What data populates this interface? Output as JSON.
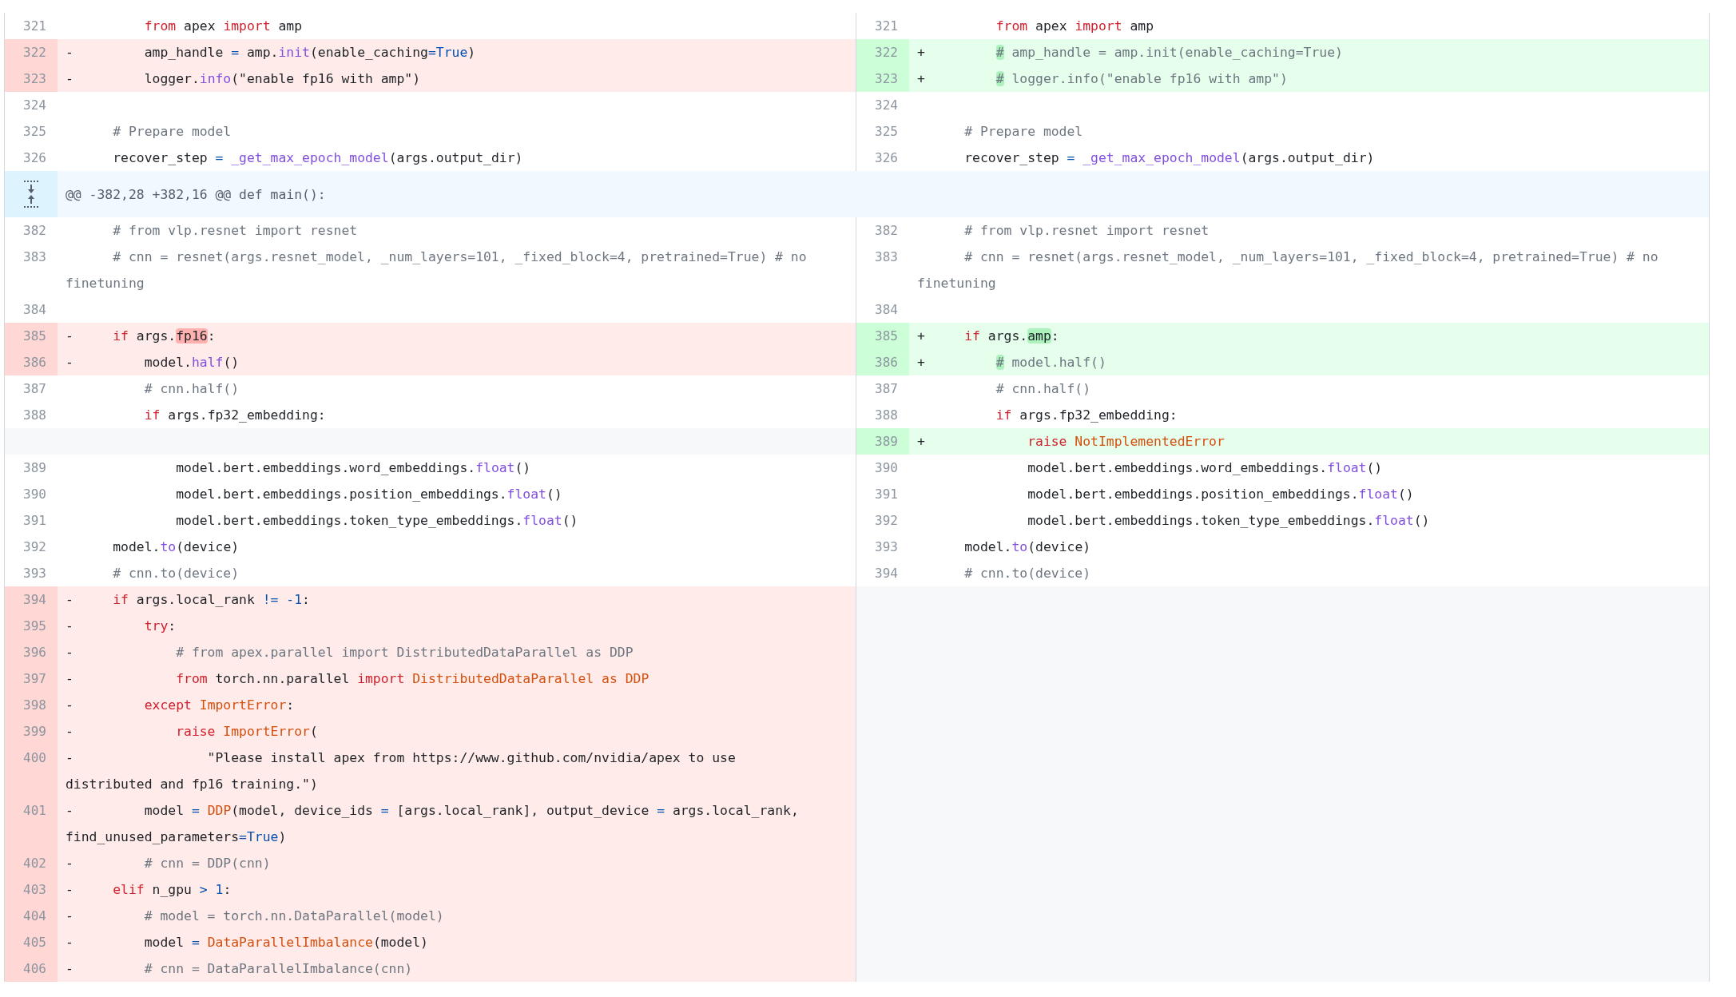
{
  "rows": [
    {
      "kind": "line",
      "left": {
        "num": "321",
        "kind": "ctx",
        "code": [
          {
            "t": "        from",
            "kind": "kw"
          },
          {
            "t": " apex "
          },
          {
            "t": "import",
            "kind": "kw"
          },
          {
            "t": " amp"
          }
        ]
      },
      "right": {
        "num": "321",
        "kind": "ctx",
        "code": [
          {
            "t": "        from",
            "kind": "kw"
          },
          {
            "t": " apex "
          },
          {
            "t": "import",
            "kind": "kw"
          },
          {
            "t": " amp"
          }
        ]
      }
    },
    {
      "kind": "line",
      "left": {
        "num": "322",
        "kind": "del",
        "marker": "-",
        "code": [
          {
            "t": "        amp_handle "
          },
          {
            "t": "=",
            "kind": "op"
          },
          {
            "t": " amp."
          },
          {
            "t": "init",
            "kind": "fn"
          },
          {
            "t": "(enable_caching"
          },
          {
            "t": "=",
            "kind": "op"
          },
          {
            "t": "True",
            "kind": "op"
          },
          {
            "t": ")"
          }
        ]
      },
      "right": {
        "num": "322",
        "kind": "add",
        "marker": "+",
        "code": [
          {
            "t": "        #",
            "kind": "cm",
            "hl": true
          },
          {
            "t": " amp_handle = amp.init(enable_caching=True)",
            "kind": "cm"
          }
        ]
      }
    },
    {
      "kind": "line",
      "left": {
        "num": "323",
        "kind": "del",
        "marker": "-",
        "code": [
          {
            "t": "        logger."
          },
          {
            "t": "info",
            "kind": "fn"
          },
          {
            "t": "(\"enable fp16 with amp\")"
          }
        ]
      },
      "right": {
        "num": "323",
        "kind": "add",
        "marker": "+",
        "code": [
          {
            "t": "        #",
            "kind": "cm",
            "hl": true
          },
          {
            "t": " logger.info(\"enable fp16 with amp\")",
            "kind": "cm"
          }
        ]
      }
    },
    {
      "kind": "line",
      "left": {
        "num": "324",
        "kind": "ctx"
      },
      "right": {
        "num": "324",
        "kind": "ctx"
      }
    },
    {
      "kind": "line",
      "left": {
        "num": "325",
        "kind": "ctx",
        "code": [
          {
            "t": "    # Prepare model",
            "kind": "cm"
          }
        ]
      },
      "right": {
        "num": "325",
        "kind": "ctx",
        "code": [
          {
            "t": "    # Prepare model",
            "kind": "cm"
          }
        ]
      }
    },
    {
      "kind": "line",
      "left": {
        "num": "326",
        "kind": "ctx",
        "code": [
          {
            "t": "    recover_step "
          },
          {
            "t": "= ",
            "kind": "op"
          },
          {
            "t": "_get_max_epoch_model",
            "kind": "fn"
          },
          {
            "t": "(args.output_dir)"
          }
        ]
      },
      "right": {
        "num": "326",
        "kind": "ctx",
        "code": [
          {
            "t": "    recover_step "
          },
          {
            "t": "= ",
            "kind": "op"
          },
          {
            "t": "_get_max_epoch_model",
            "kind": "fn"
          },
          {
            "t": "(args.output_dir)"
          }
        ]
      }
    },
    {
      "kind": "hunk",
      "text": "@@ -382,28 +382,16 @@ def main():"
    },
    {
      "kind": "line",
      "left": {
        "num": "382",
        "kind": "ctx",
        "code": [
          {
            "t": "    # from vlp.resnet import resnet",
            "kind": "cm"
          }
        ]
      },
      "right": {
        "num": "382",
        "kind": "ctx",
        "code": [
          {
            "t": "    # from vlp.resnet import resnet",
            "kind": "cm"
          }
        ]
      }
    },
    {
      "kind": "line",
      "left": {
        "num": "383",
        "kind": "ctx",
        "code": [
          {
            "t": "    # cnn = resnet(args.resnet_model, _num_layers=101, _fixed_block=4, pretrained=True) # no finetuning",
            "kind": "cm"
          }
        ]
      },
      "right": {
        "num": "383",
        "kind": "ctx",
        "code": [
          {
            "t": "    # cnn = resnet(args.resnet_model, _num_layers=101, _fixed_block=4, pretrained=True) # no finetuning",
            "kind": "cm"
          }
        ]
      }
    },
    {
      "kind": "line",
      "left": {
        "num": "384",
        "kind": "ctx"
      },
      "right": {
        "num": "384",
        "kind": "ctx"
      }
    },
    {
      "kind": "line",
      "left": {
        "num": "385",
        "kind": "del",
        "marker": "-",
        "code": [
          {
            "t": "    if",
            "kind": "kw"
          },
          {
            "t": " args."
          },
          {
            "t": "fp16",
            "hl": true
          },
          {
            "t": ":"
          }
        ]
      },
      "right": {
        "num": "385",
        "kind": "add",
        "marker": "+",
        "code": [
          {
            "t": "    if",
            "kind": "kw"
          },
          {
            "t": " args."
          },
          {
            "t": "amp",
            "hl": true
          },
          {
            "t": ":"
          }
        ]
      }
    },
    {
      "kind": "line",
      "left": {
        "num": "386",
        "kind": "del",
        "marker": "-",
        "code": [
          {
            "t": "        model."
          },
          {
            "t": "half",
            "kind": "fn"
          },
          {
            "t": "()"
          }
        ]
      },
      "right": {
        "num": "386",
        "kind": "add",
        "marker": "+",
        "code": [
          {
            "t": "        #",
            "kind": "cm",
            "hl": true
          },
          {
            "t": " model.half()",
            "kind": "cm"
          }
        ]
      }
    },
    {
      "kind": "line",
      "left": {
        "num": "387",
        "kind": "ctx",
        "code": [
          {
            "t": "        # cnn.half()",
            "kind": "cm"
          }
        ]
      },
      "right": {
        "num": "387",
        "kind": "ctx",
        "code": [
          {
            "t": "        # cnn.half()",
            "kind": "cm"
          }
        ]
      }
    },
    {
      "kind": "line",
      "left": {
        "num": "388",
        "kind": "ctx",
        "code": [
          {
            "t": "        if",
            "kind": "kw"
          },
          {
            "t": " args.fp32_embedding:"
          }
        ]
      },
      "right": {
        "num": "388",
        "kind": "ctx",
        "code": [
          {
            "t": "        if",
            "kind": "kw"
          },
          {
            "t": " args.fp32_embedding:"
          }
        ]
      }
    },
    {
      "kind": "line",
      "left": {
        "kind": "blank"
      },
      "right": {
        "num": "389",
        "kind": "add",
        "marker": "+",
        "code": [
          {
            "t": "            raise",
            "kind": "kw"
          },
          {
            "t": " NotImplementedError",
            "kind": "cls"
          }
        ]
      }
    },
    {
      "kind": "line",
      "left": {
        "num": "389",
        "kind": "ctx",
        "code": [
          {
            "t": "            model.bert.embeddings.word_embeddings."
          },
          {
            "t": "float",
            "kind": "fn"
          },
          {
            "t": "()"
          }
        ]
      },
      "right": {
        "num": "390",
        "kind": "ctx",
        "code": [
          {
            "t": "            model.bert.embeddings.word_embeddings."
          },
          {
            "t": "float",
            "kind": "fn"
          },
          {
            "t": "()"
          }
        ]
      }
    },
    {
      "kind": "line",
      "left": {
        "num": "390",
        "kind": "ctx",
        "code": [
          {
            "t": "            model.bert.embeddings.position_embeddings."
          },
          {
            "t": "float",
            "kind": "fn"
          },
          {
            "t": "()"
          }
        ]
      },
      "right": {
        "num": "391",
        "kind": "ctx",
        "code": [
          {
            "t": "            model.bert.embeddings.position_embeddings."
          },
          {
            "t": "float",
            "kind": "fn"
          },
          {
            "t": "()"
          }
        ]
      }
    },
    {
      "kind": "line",
      "left": {
        "num": "391",
        "kind": "ctx",
        "code": [
          {
            "t": "            model.bert.embeddings.token_type_embeddings."
          },
          {
            "t": "float",
            "kind": "fn"
          },
          {
            "t": "()"
          }
        ]
      },
      "right": {
        "num": "392",
        "kind": "ctx",
        "code": [
          {
            "t": "            model.bert.embeddings.token_type_embeddings."
          },
          {
            "t": "float",
            "kind": "fn"
          },
          {
            "t": "()"
          }
        ]
      }
    },
    {
      "kind": "line",
      "left": {
        "num": "392",
        "kind": "ctx",
        "code": [
          {
            "t": "    model."
          },
          {
            "t": "to",
            "kind": "fn"
          },
          {
            "t": "(device)"
          }
        ]
      },
      "right": {
        "num": "393",
        "kind": "ctx",
        "code": [
          {
            "t": "    model."
          },
          {
            "t": "to",
            "kind": "fn"
          },
          {
            "t": "(device)"
          }
        ]
      }
    },
    {
      "kind": "line",
      "left": {
        "num": "393",
        "kind": "ctx",
        "code": [
          {
            "t": "    # cnn.to(device)",
            "kind": "cm"
          }
        ]
      },
      "right": {
        "num": "394",
        "kind": "ctx",
        "code": [
          {
            "t": "    # cnn.to(device)",
            "kind": "cm"
          }
        ]
      }
    },
    {
      "kind": "line",
      "left": {
        "num": "394",
        "kind": "del",
        "marker": "-",
        "code": [
          {
            "t": "    if",
            "kind": "kw"
          },
          {
            "t": " args.local_rank "
          },
          {
            "t": "!= -1",
            "kind": "op"
          },
          {
            "t": ":"
          }
        ]
      },
      "right": {
        "kind": "blank"
      }
    },
    {
      "kind": "line",
      "left": {
        "num": "395",
        "kind": "del",
        "marker": "-",
        "code": [
          {
            "t": "        try",
            "kind": "kw"
          },
          {
            "t": ":"
          }
        ]
      },
      "right": {
        "kind": "blank"
      }
    },
    {
      "kind": "line",
      "left": {
        "num": "396",
        "kind": "del",
        "marker": "-",
        "code": [
          {
            "t": "            # from apex.parallel import DistributedDataParallel as DDP",
            "kind": "cm"
          }
        ]
      },
      "right": {
        "kind": "blank"
      }
    },
    {
      "kind": "line",
      "left": {
        "num": "397",
        "kind": "del",
        "marker": "-",
        "code": [
          {
            "t": "            from",
            "kind": "kw"
          },
          {
            "t": " torch.nn.parallel "
          },
          {
            "t": "import",
            "kind": "kw"
          },
          {
            "t": " DistributedDataParallel as DDP",
            "kind": "cls"
          }
        ]
      },
      "right": {
        "kind": "blank"
      }
    },
    {
      "kind": "line",
      "left": {
        "num": "398",
        "kind": "del",
        "marker": "-",
        "code": [
          {
            "t": "        except",
            "kind": "kw"
          },
          {
            "t": " ImportError",
            "kind": "cls"
          },
          {
            "t": ":"
          }
        ]
      },
      "right": {
        "kind": "blank"
      }
    },
    {
      "kind": "line",
      "left": {
        "num": "399",
        "kind": "del",
        "marker": "-",
        "code": [
          {
            "t": "            raise",
            "kind": "kw"
          },
          {
            "t": " ImportError",
            "kind": "cls"
          },
          {
            "t": "("
          }
        ]
      },
      "right": {
        "kind": "blank"
      }
    },
    {
      "kind": "line",
      "left": {
        "num": "400",
        "kind": "del",
        "marker": "-",
        "code": [
          {
            "t": "                \"Please install apex from https://www.github.com/nvidia/apex to use distributed and fp16 training.\")"
          }
        ]
      },
      "right": {
        "kind": "blank"
      }
    },
    {
      "kind": "line",
      "left": {
        "num": "401",
        "kind": "del",
        "marker": "-",
        "code": [
          {
            "t": "        model "
          },
          {
            "t": "= ",
            "kind": "op"
          },
          {
            "t": "DDP",
            "kind": "cls"
          },
          {
            "t": "(model, device_ids "
          },
          {
            "t": "=",
            "kind": "op"
          },
          {
            "t": " [args.local_rank], output_device "
          },
          {
            "t": "=",
            "kind": "op"
          },
          {
            "t": " args.local_rank, find_unused_parameters"
          },
          {
            "t": "=True",
            "kind": "op"
          },
          {
            "t": ")"
          }
        ]
      },
      "right": {
        "kind": "blank"
      }
    },
    {
      "kind": "line",
      "left": {
        "num": "402",
        "kind": "del",
        "marker": "-",
        "code": [
          {
            "t": "        # cnn = DDP(cnn)",
            "kind": "cm"
          }
        ]
      },
      "right": {
        "kind": "blank"
      }
    },
    {
      "kind": "line",
      "left": {
        "num": "403",
        "kind": "del",
        "marker": "-",
        "code": [
          {
            "t": "    elif",
            "kind": "kw"
          },
          {
            "t": " n_gpu "
          },
          {
            "t": "> 1",
            "kind": "op"
          },
          {
            "t": ":"
          }
        ]
      },
      "right": {
        "kind": "blank"
      }
    },
    {
      "kind": "line",
      "left": {
        "num": "404",
        "kind": "del",
        "marker": "-",
        "code": [
          {
            "t": "        # model = torch.nn.DataParallel(model)",
            "kind": "cm"
          }
        ]
      },
      "right": {
        "kind": "blank"
      }
    },
    {
      "kind": "line",
      "left": {
        "num": "405",
        "kind": "del",
        "marker": "-",
        "code": [
          {
            "t": "        model "
          },
          {
            "t": "= ",
            "kind": "op"
          },
          {
            "t": "DataParallelImbalance",
            "kind": "cls"
          },
          {
            "t": "(model)"
          }
        ]
      },
      "right": {
        "kind": "blank"
      }
    },
    {
      "kind": "line",
      "left": {
        "num": "406",
        "kind": "del",
        "marker": "-",
        "code": [
          {
            "t": "        # cnn = DataParallelImbalance(cnn)",
            "kind": "cm"
          }
        ]
      },
      "right": {
        "kind": "blank"
      }
    }
  ]
}
